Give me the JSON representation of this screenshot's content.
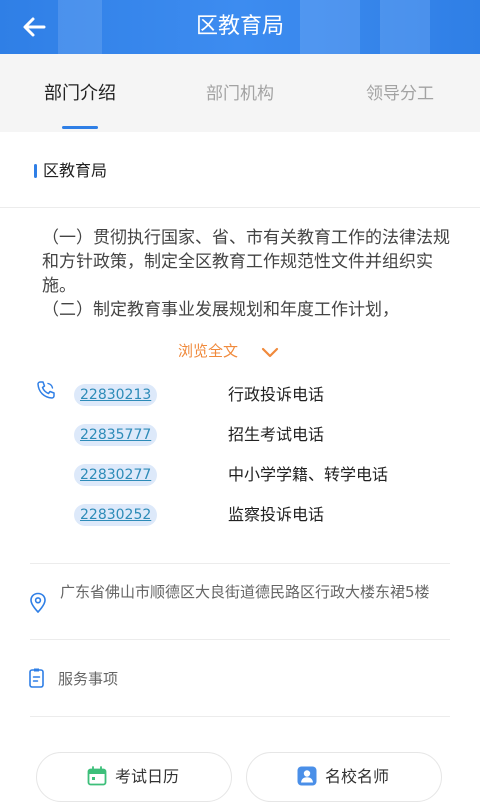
{
  "header": {
    "title": "区教育局",
    "back_icon": "arrow-left-icon"
  },
  "tabs": [
    {
      "label": "部门介绍",
      "active": true
    },
    {
      "label": "部门机构",
      "active": false
    },
    {
      "label": "领导分工",
      "active": false
    }
  ],
  "section": {
    "title": "区教育局"
  },
  "intro": {
    "lines": [
      "（一）贯彻执行国家、省、市有关教育工作的法律法规和方针政策，制定全区教育工作规范性文件并组织实施。",
      "（二）制定教育事业发展规划和年度工作计划，"
    ],
    "expand_label": "浏览全文"
  },
  "phones": [
    {
      "number": "22830213",
      "label": "行政投诉电话"
    },
    {
      "number": "22835777",
      "label": "招生考试电话"
    },
    {
      "number": "22830277",
      "label": "中小学学籍、转学电话"
    },
    {
      "number": "22830252",
      "label": "监察投诉电话"
    }
  ],
  "address": "广东省佛山市顺德区大良街道德民路区行政大楼东裙5楼",
  "service": {
    "label": "服务事项"
  },
  "bottom_buttons": [
    {
      "label": "考试日历",
      "icon": "calendar-icon"
    },
    {
      "label": "名校名师",
      "icon": "teacher-icon"
    }
  ],
  "colors": {
    "primary": "#2f7fe6",
    "accent": "#f08a3c",
    "phone_link": "#2d8bb8"
  }
}
